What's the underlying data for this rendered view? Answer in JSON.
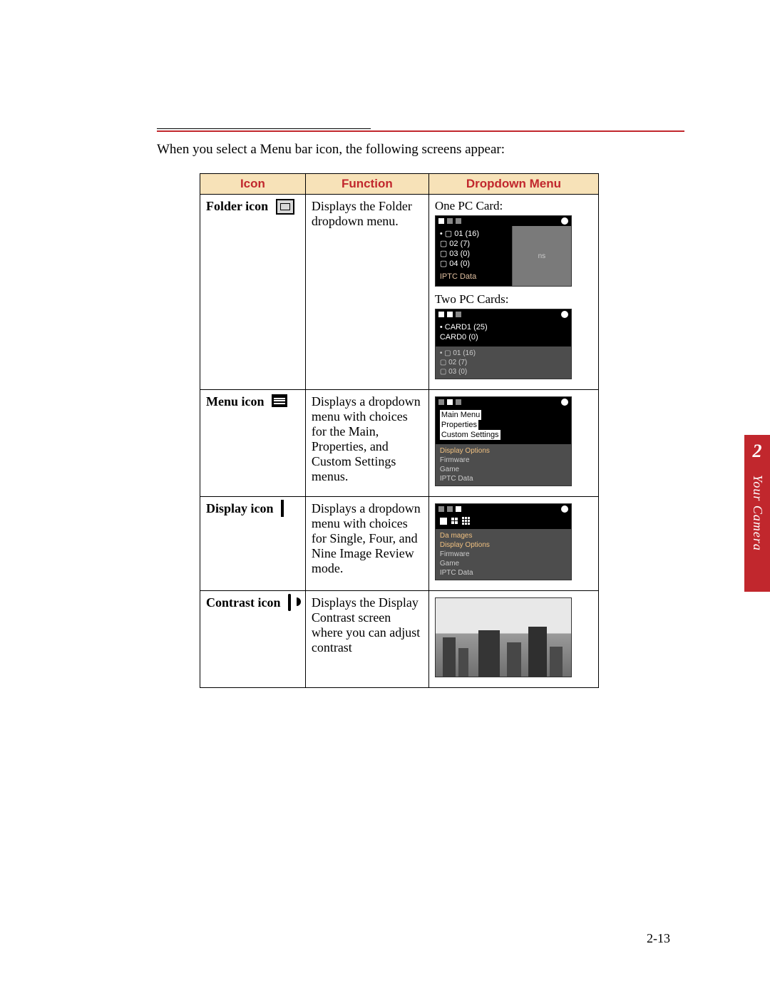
{
  "intro": "When you select a Menu bar icon, the following screens appear:",
  "headers": {
    "icon": "Icon",
    "func": "Function",
    "drop": "Dropdown Menu"
  },
  "rows": {
    "folder": {
      "label": "Folder icon",
      "func": "Displays the Folder dropdown menu.",
      "drop1_label": "One PC Card:",
      "drop2_label": "Two PC Cards:",
      "lcd1": {
        "lines": [
          "• ▢ 01  (16)",
          "▢ 02  (7)",
          "▢ 03  (0)",
          "▢ 04  (0)"
        ],
        "footer": "IPTC Data",
        "side_note": "ns"
      },
      "lcd2": {
        "top": [
          "• CARD1  (25)",
          "  CARD0  (0)"
        ],
        "lines": [
          "• ▢ 01  (16)",
          "▢ 02  (7)",
          "▢ 03  (0)"
        ]
      }
    },
    "menu": {
      "label": "Menu icon",
      "func": "Displays a dropdown menu with choices for the Main, Properties, and Custom Settings menus.",
      "lcd": {
        "hl": [
          "Main Menu",
          "Properties",
          "Custom Settings"
        ],
        "dim_label": "Display Options",
        "rest": [
          "Firmware",
          "Game",
          "IPTC Data"
        ]
      }
    },
    "display": {
      "label": "Display icon",
      "func": "Displays a dropdown menu with choices for Single, Four, and Nine Image Review mode.",
      "lcd": {
        "grid_label": "mages",
        "rest": [
          "Display Options",
          "Firmware",
          "Game",
          "IPTC Data"
        ]
      }
    },
    "contrast": {
      "label": "Contrast icon",
      "func": "Displays the Display Contrast screen where you can adjust contrast"
    }
  },
  "sidetab": {
    "num": "2",
    "label": "Your Camera"
  },
  "pageno": "2-13"
}
